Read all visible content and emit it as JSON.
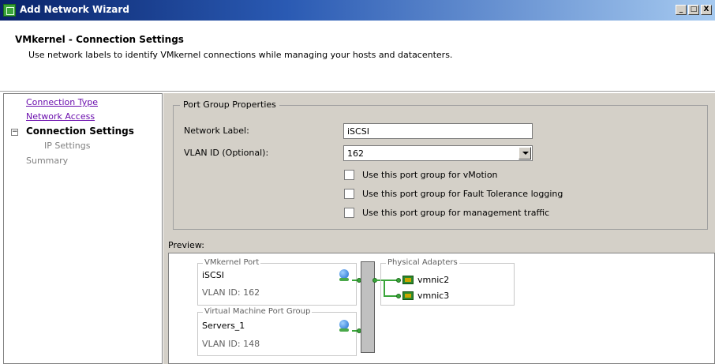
{
  "window": {
    "title": "Add Network Wizard",
    "minimize_label": "_",
    "maximize_label": "□",
    "close_label": "X"
  },
  "header": {
    "title": "VMkernel - Connection Settings",
    "subtitle": "Use network labels to identify VMkernel connections while managing your hosts and datacenters."
  },
  "sidebar": {
    "items": [
      {
        "label": "Connection Type"
      },
      {
        "label": "Network Access"
      },
      {
        "label": "Connection Settings"
      },
      {
        "label": "IP Settings"
      },
      {
        "label": "Summary"
      }
    ],
    "collapse_glyph": "−"
  },
  "port_group": {
    "legend": "Port Group Properties",
    "network_label": {
      "label": "Network Label:",
      "value": "iSCSI"
    },
    "vlan_id": {
      "label": "VLAN ID (Optional):",
      "value": "162"
    },
    "checkboxes": [
      {
        "label": "Use this port group for vMotion",
        "checked": false
      },
      {
        "label": "Use this port group for Fault Tolerance logging",
        "checked": false
      },
      {
        "label": "Use this port group for management traffic",
        "checked": false
      }
    ]
  },
  "preview": {
    "label": "Preview:",
    "vmkernel_port": {
      "legend": "VMkernel Port",
      "name": "iSCSI",
      "vlan": "VLAN ID: 162"
    },
    "vm_port_group": {
      "legend": "Virtual Machine Port Group",
      "name": "Servers_1",
      "vlan": "VLAN ID: 148"
    },
    "physical_adapters": {
      "legend": "Physical Adapters",
      "nics": [
        "vmnic2",
        "vmnic3"
      ]
    }
  }
}
